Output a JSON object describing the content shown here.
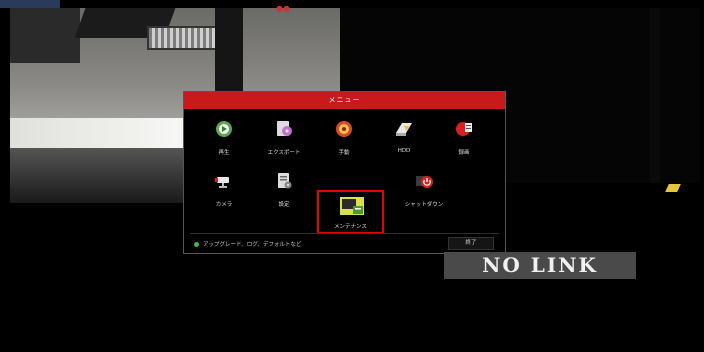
{
  "menu": {
    "title": "メニュー",
    "items": [
      {
        "label": "再生",
        "icon": "playback-icon"
      },
      {
        "label": "エクスポート",
        "icon": "export-icon"
      },
      {
        "label": "手動",
        "icon": "manual-icon"
      },
      {
        "label": "HDD",
        "icon": "hdd-icon"
      },
      {
        "label": "録画",
        "icon": "record-icon"
      },
      {
        "label": "カメラ",
        "icon": "camera-icon"
      },
      {
        "label": "設定",
        "icon": "configuration-icon"
      },
      {
        "label": "メンテナンス",
        "icon": "maintenance-icon",
        "selected": true
      },
      {
        "label": "シャットダウン",
        "icon": "shutdown-icon"
      }
    ],
    "status_text": "アップグレード、ログ、デフォルトなど",
    "exit_label": "終了"
  },
  "overlay": {
    "no_link": "NO LINK"
  },
  "colors": {
    "header_red": "#c81a1a",
    "selection_red": "#e00000",
    "status_green": "#4caf50"
  }
}
